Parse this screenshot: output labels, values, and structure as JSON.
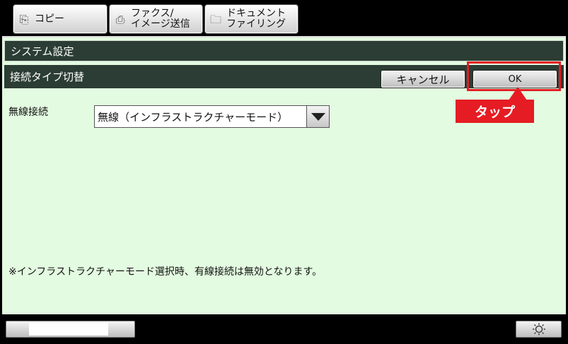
{
  "tabs": [
    {
      "label": "コピー",
      "icon": "copy-icon"
    },
    {
      "label": "ファクス/\nイメージ送信",
      "icon": "fax-send-icon"
    },
    {
      "label": "ドキュメント\nファイリング",
      "icon": "document-filing-icon"
    }
  ],
  "header": {
    "title": "システム設定",
    "subtitle": "接続タイプ切替"
  },
  "buttons": {
    "cancel": "キャンセル",
    "ok": "OK"
  },
  "annotation": {
    "tap_label": "タップ",
    "color": "#e51c23"
  },
  "form": {
    "label": "無線接続",
    "select_value": "無線（インフラストラクチャーモード）"
  },
  "note": "※インフラストラクチャーモード選択時、有線接続は無効となります。",
  "footer": {
    "brightness_icon": "sun-icon"
  },
  "colors": {
    "header_bg": "#2b3d34",
    "panel_bg": "#e3fbe0"
  }
}
